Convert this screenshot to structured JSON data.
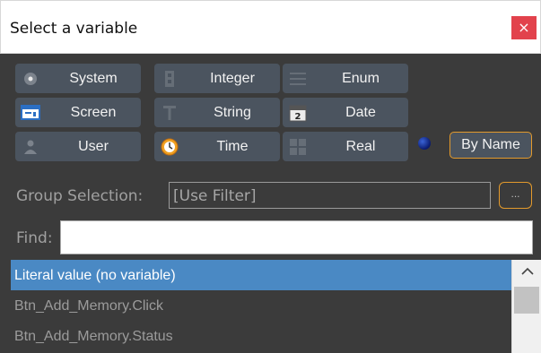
{
  "dialog": {
    "title": "Select a variable",
    "close_glyph": "×"
  },
  "type_buttons": [
    {
      "label": "System",
      "icon": "system-icon"
    },
    {
      "label": "Integer",
      "icon": "integer-icon"
    },
    {
      "label": "Enum",
      "icon": "enum-icon"
    },
    {
      "label": "Screen",
      "icon": "screen-icon"
    },
    {
      "label": "String",
      "icon": "string-icon"
    },
    {
      "label": "Date",
      "icon": "date-icon"
    },
    {
      "label": "User",
      "icon": "user-icon"
    },
    {
      "label": "Time",
      "icon": "clock-icon"
    },
    {
      "label": "Real",
      "icon": "real-icon"
    }
  ],
  "date_icon_text": "2",
  "by_name_label": "By Name",
  "group": {
    "label": "Group Selection:",
    "value": "[Use Filter]",
    "browse_label": "..."
  },
  "find": {
    "label": "Find:",
    "value": ""
  },
  "variables": [
    "Literal value (no variable)",
    "Btn_Add_Memory.Click",
    "Btn_Add_Memory.Status"
  ],
  "colors": {
    "accent": "#e39a2c",
    "selection": "#4a89c4",
    "button_bg": "#4b545f",
    "close": "#e2424c"
  }
}
